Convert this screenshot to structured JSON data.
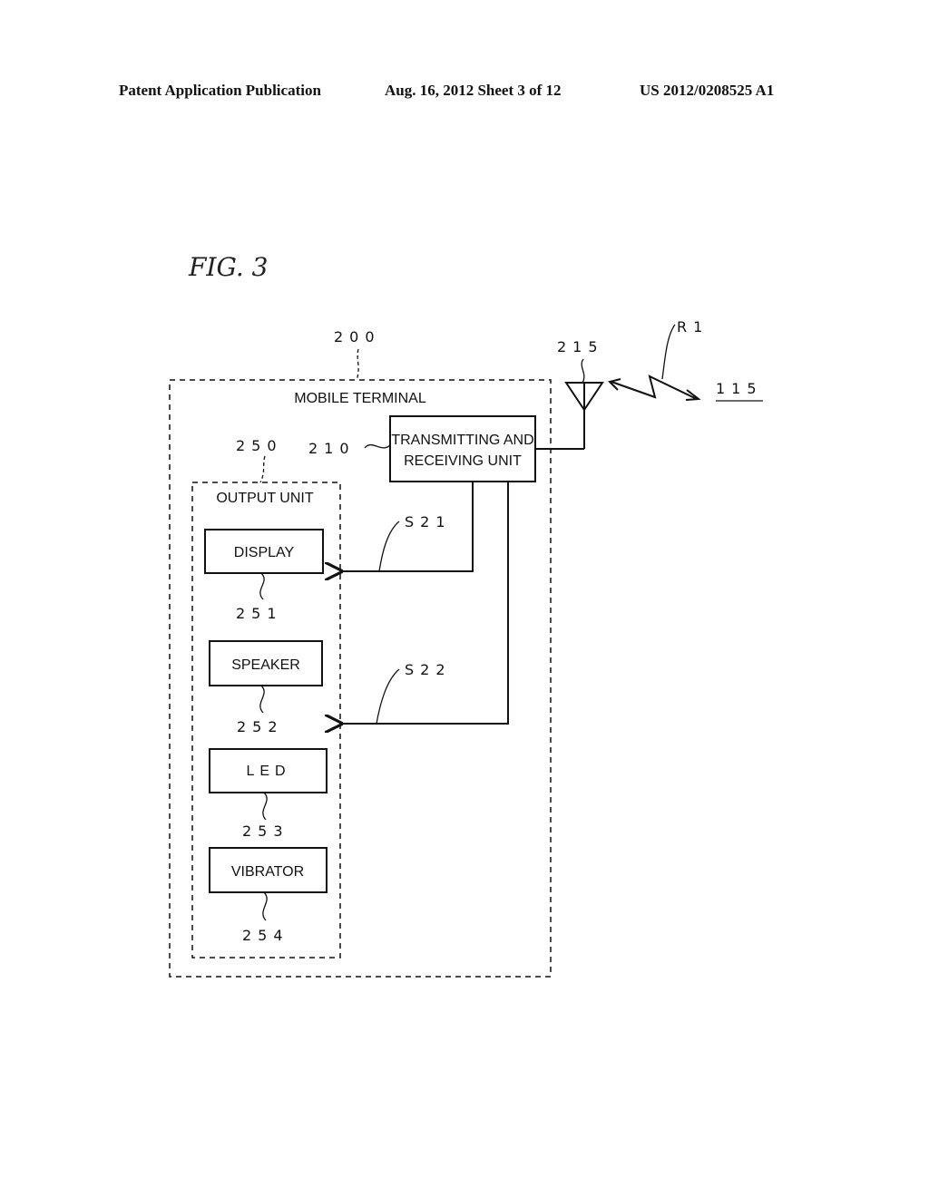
{
  "header": {
    "left": "Patent Application Publication",
    "middle": "Aug. 16, 2012  Sheet 3 of 12",
    "right": "US 2012/0208525 A1"
  },
  "figure": {
    "title": "FIG. 3",
    "mobile_terminal": {
      "ref": "200",
      "label": "MOBILE TERMINAL"
    },
    "transceiver": {
      "ref": "210",
      "line1": "TRANSMITTING AND",
      "line2": "RECEIVING UNIT"
    },
    "antenna": {
      "ref": "215"
    },
    "radio_link": {
      "ref": "R1"
    },
    "remote": {
      "ref": "115"
    },
    "output_unit": {
      "ref": "250",
      "label": "OUTPUT UNIT"
    },
    "signals": {
      "s21": "S21",
      "s22": "S22"
    },
    "components": [
      {
        "label": "DISPLAY",
        "ref": "251"
      },
      {
        "label": "SPEAKER",
        "ref": "252"
      },
      {
        "label": "LED",
        "ref": "253"
      },
      {
        "label": "VIBRATOR",
        "ref": "254"
      }
    ]
  }
}
